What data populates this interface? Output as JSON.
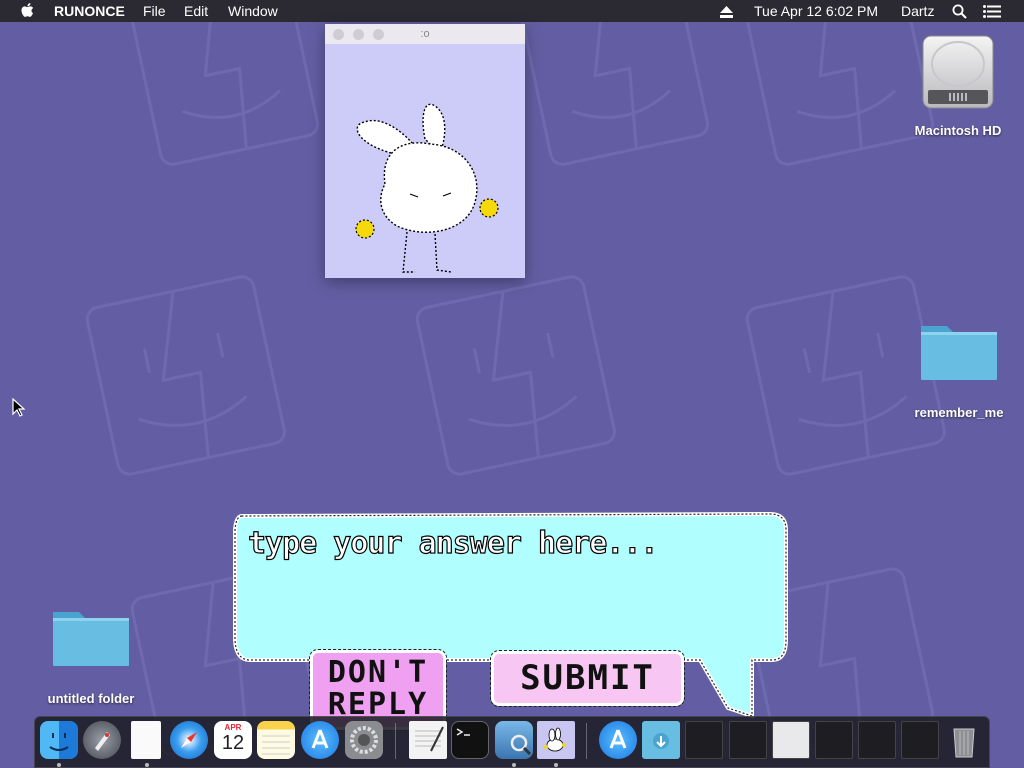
{
  "menubar": {
    "app_name": "RUNONCE",
    "menus": [
      "File",
      "Edit",
      "Window"
    ],
    "clock": "Tue Apr 12  6:02 PM",
    "user": "Dartz"
  },
  "desktop": {
    "icons": [
      {
        "label": "Macintosh HD",
        "kind": "hard-drive"
      },
      {
        "label": "remember_me",
        "kind": "folder"
      },
      {
        "label": "untitled folder",
        "kind": "folder"
      }
    ]
  },
  "bunny_window": {
    "title": ":o"
  },
  "dialog": {
    "placeholder": "type your answer here...",
    "dont_reply_label": "DON'T REPLY",
    "submit_label": "SUBMIT"
  },
  "dock": {
    "calendar_month": "APR",
    "calendar_day": "12",
    "items": [
      "Finder",
      "Launchpad",
      "Document",
      "Safari",
      "Calendar",
      "Notes",
      "App Store",
      "System Preferences",
      "TextEdit",
      "Terminal",
      "Preview",
      "Runonce",
      "App Store",
      "Downloads",
      "Window 1",
      "Window 2",
      "Window 3",
      "Window 4",
      "Window 5",
      "Window 6",
      "Trash"
    ]
  },
  "colors": {
    "desktop_bg": "#635ea3",
    "bubble": "#b0fefe",
    "dont_reply_bg": "#f0a0f0",
    "submit_bg": "#f7c6f3",
    "bunny_window_bg": "#cdcbf7"
  }
}
